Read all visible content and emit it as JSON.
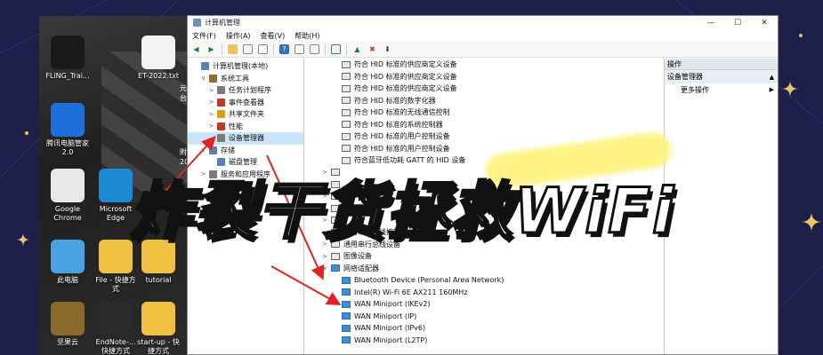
{
  "window": {
    "title": "计算机管理",
    "controls": [
      "—",
      "☐",
      "✕"
    ]
  },
  "menu": [
    "文件(F)",
    "操作(A)",
    "查看(V)",
    "帮助(H)"
  ],
  "tree": [
    {
      "label": "计算机管理(本地)",
      "indent": 0,
      "expander": "",
      "color": "#5b7fb0"
    },
    {
      "label": "系统工具",
      "indent": 1,
      "expander": "∨",
      "color": "#8a6d3b"
    },
    {
      "label": "任务计划程序",
      "indent": 2,
      "expander": ">",
      "color": "#7a7a7a"
    },
    {
      "label": "事件查看器",
      "indent": 2,
      "expander": ">",
      "color": "#c0392b"
    },
    {
      "label": "共享文件夹",
      "indent": 2,
      "expander": ">",
      "color": "#d4a017"
    },
    {
      "label": "性能",
      "indent": 2,
      "expander": ">",
      "color": "#c0392b"
    },
    {
      "label": "设备管理器",
      "indent": 2,
      "expander": "",
      "color": "#7a7a7a",
      "selected": true
    },
    {
      "label": "存储",
      "indent": 1,
      "expander": "∨",
      "color": "#5b7fb0"
    },
    {
      "label": "磁盘管理",
      "indent": 2,
      "expander": "",
      "color": "#5b7fb0"
    },
    {
      "label": "服务和应用程序",
      "indent": 1,
      "expander": ">",
      "color": "#7a7a7a"
    }
  ],
  "devices": [
    {
      "label": "符合 HID 标准的供应商定义设备",
      "type": "hid",
      "indent": 2,
      "expander": ""
    },
    {
      "label": "符合 HID 标准的供应商定义设备",
      "type": "hid",
      "indent": 2,
      "expander": ""
    },
    {
      "label": "符合 HID 标准的供应商定义设备",
      "type": "hid",
      "indent": 2,
      "expander": ""
    },
    {
      "label": "符合 HID 标准的数字化器",
      "type": "hid",
      "indent": 2,
      "expander": ""
    },
    {
      "label": "符合 HID 标准的无线通信控制",
      "type": "hid",
      "indent": 2,
      "expander": ""
    },
    {
      "label": "符合 HID 标准的系统控制器",
      "type": "hid",
      "indent": 2,
      "expander": ""
    },
    {
      "label": "符合 HID 标准的用户控制设备",
      "type": "hid",
      "indent": 2,
      "expander": ""
    },
    {
      "label": "符合 HID 标准的用户控制设备",
      "type": "hid",
      "indent": 2,
      "expander": ""
    },
    {
      "label": "符合蓝牙低功耗 GATT 的 HID 设备",
      "type": "hid",
      "indent": 2,
      "expander": ""
    },
    {
      "label": "",
      "type": "hid",
      "indent": 1,
      "expander": ">"
    },
    {
      "label": "",
      "type": "hid",
      "indent": 1,
      "expander": ">"
    },
    {
      "label": "",
      "type": "hid",
      "indent": 1,
      "expander": ">"
    },
    {
      "label": "",
      "type": "hid",
      "indent": 1,
      "expander": ">"
    },
    {
      "label": "",
      "type": "hid",
      "indent": 1,
      "expander": ">"
    },
    {
      "label": "通用串行总线控制器",
      "type": "hid",
      "indent": 1,
      "expander": ">"
    },
    {
      "label": "通用串行总线设备",
      "type": "hid",
      "indent": 1,
      "expander": ">"
    },
    {
      "label": "图像设备",
      "type": "hid",
      "indent": 1,
      "expander": ">"
    },
    {
      "label": "网络适配器",
      "type": "net",
      "indent": 1,
      "expander": "∨"
    },
    {
      "label": "Bluetooth Device (Personal Area Network)",
      "type": "net",
      "indent": 2,
      "expander": ""
    },
    {
      "label": "Intel(R) Wi-Fi 6E AX211 160MHz",
      "type": "net",
      "indent": 2,
      "expander": ""
    },
    {
      "label": "WAN Miniport (IKEv2)",
      "type": "net",
      "indent": 2,
      "expander": ""
    },
    {
      "label": "WAN Miniport (IP)",
      "type": "net",
      "indent": 2,
      "expander": ""
    },
    {
      "label": "WAN Miniport (IPv6)",
      "type": "net",
      "indent": 2,
      "expander": ""
    },
    {
      "label": "WAN Miniport (L2TP)",
      "type": "net",
      "indent": 2,
      "expander": ""
    }
  ],
  "actions": {
    "header": "操作",
    "section": "设备管理器",
    "item": "更多操作"
  },
  "desktop_icons": [
    {
      "label": "FLiNG_Trai...",
      "color": "#1a1a1a"
    },
    {
      "label": "ET-2022.txt",
      "color": "#f2f2f2"
    },
    {
      "label": "腾讯电脑管家\n2.0",
      "color": "#1e6fd9"
    },
    {
      "label": "Google\nChrome",
      "color": "#e8e8e8"
    },
    {
      "label": "Microsoft\nEdge",
      "color": "#1d8ad6"
    },
    {
      "label": "此电脑",
      "color": "#4aa3e0"
    },
    {
      "label": "File - 快捷方\n式",
      "color": "#f0c040"
    },
    {
      "label": "tutorial",
      "color": "#f0c040"
    },
    {
      "label": "坚果云",
      "color": "#8a6a2a"
    },
    {
      "label": "EndNote-...\n快捷方式",
      "color": "#2a2a2a"
    },
    {
      "label": "start-up - 快\n捷方式",
      "color": "#f0c040"
    }
  ],
  "desktop_side_text": [
    "元",
    "台",
    "附",
    "20"
  ],
  "overlay": {
    "headline": "炸裂干货拯救WiFi",
    "highlight_color": "#fff27a"
  },
  "colors": {
    "background": "#1d1f4a",
    "accent_gold": "#e9c46a",
    "arrow_red": "#e02424",
    "selection": "#cce4f7"
  }
}
